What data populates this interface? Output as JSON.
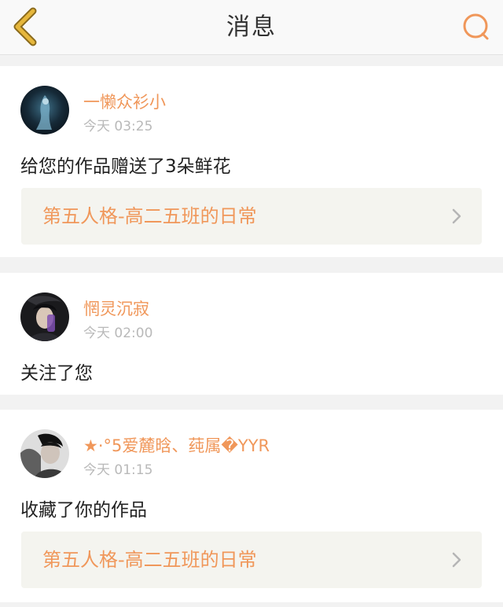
{
  "header": {
    "title": "消息",
    "back_icon": "chevron-left-icon",
    "search_icon": "search-icon",
    "accent_color": "#f0975a",
    "back_color": "#e6b73c"
  },
  "messages": [
    {
      "username": "一懒众衫小",
      "time": "今天 03:25",
      "action": "给您的作品赠送了3朵鲜花",
      "work_title": "第五人格-高二五班的日常"
    },
    {
      "username": "惘灵沉寂",
      "time": "今天 02:00",
      "action": "关注了您"
    },
    {
      "username": "★·°5爱麓晗、莼属�YYR",
      "time": "今天 01:15",
      "action": "收藏了你的作品",
      "work_title": "第五人格-高二五班的日常"
    }
  ]
}
